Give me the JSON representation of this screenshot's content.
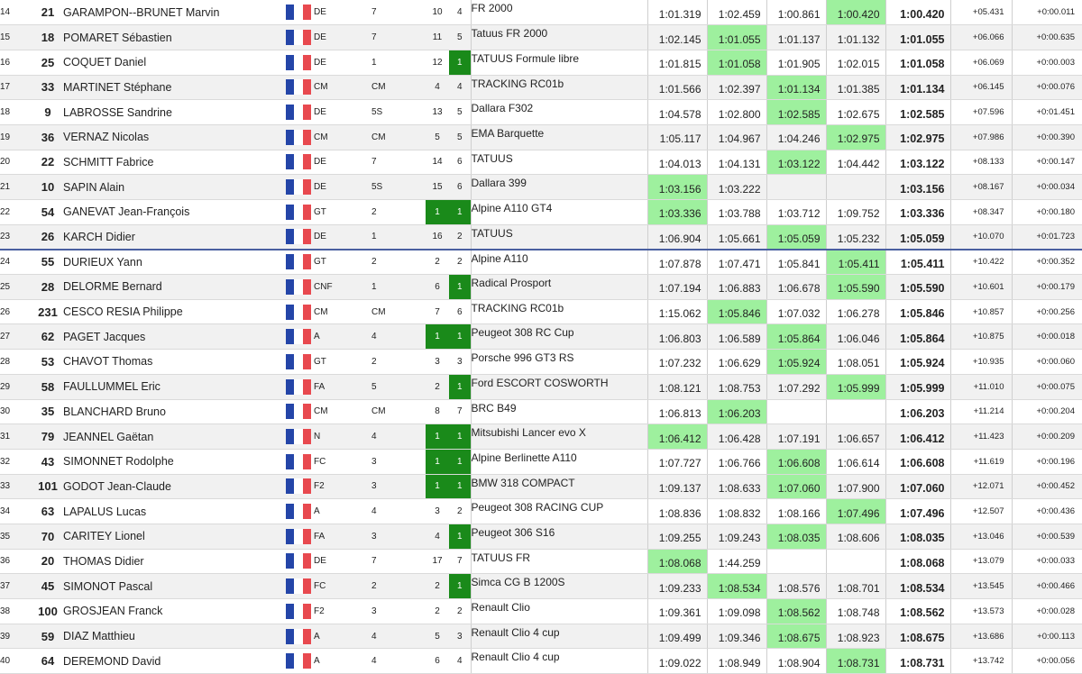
{
  "colors": {
    "highlight": "#9ef09e",
    "green_box": "#1a8a1a",
    "separator": "#4a5fa0",
    "flag_blue": "#2445a8",
    "flag_white": "#ffffff",
    "flag_red": "#e8494f"
  },
  "rows": [
    {
      "rank": "14",
      "num": "21",
      "name": "GARAMPON--BRUNET Marvin",
      "cat": "DE",
      "cls": "7",
      "p1": "10",
      "p2": "4",
      "car": "FR 2000",
      "t1": "1:01.319",
      "t2": "1:02.459",
      "t3": "1:00.861",
      "t4": "1:00.420",
      "best": "1:00.420",
      "gap": "+05.431",
      "diff": "+0:00.011",
      "hl": [
        4
      ],
      "g1": false,
      "g2": false
    },
    {
      "rank": "15",
      "num": "18",
      "name": "POMARET Sébastien",
      "cat": "DE",
      "cls": "7",
      "p1": "11",
      "p2": "5",
      "car": "Tatuus FR 2000",
      "t1": "1:02.145",
      "t2": "1:01.055",
      "t3": "1:01.137",
      "t4": "1:01.132",
      "best": "1:01.055",
      "gap": "+06.066",
      "diff": "+0:00.635",
      "hl": [
        2
      ],
      "g1": false,
      "g2": false
    },
    {
      "rank": "16",
      "num": "25",
      "name": "COQUET Daniel",
      "cat": "DE",
      "cls": "1",
      "p1": "12",
      "p2": "1",
      "car": "TATUUS Formule libre",
      "t1": "1:01.815",
      "t2": "1:01.058",
      "t3": "1:01.905",
      "t4": "1:02.015",
      "best": "1:01.058",
      "gap": "+06.069",
      "diff": "+0:00.003",
      "hl": [
        2
      ],
      "g1": false,
      "g2": true
    },
    {
      "rank": "17",
      "num": "33",
      "name": "MARTINET Stéphane",
      "cat": "CM",
      "cls": "CM",
      "p1": "4",
      "p2": "4",
      "car": "TRACKING RC01b",
      "t1": "1:01.566",
      "t2": "1:02.397",
      "t3": "1:01.134",
      "t4": "1:01.385",
      "best": "1:01.134",
      "gap": "+06.145",
      "diff": "+0:00.076",
      "hl": [
        3
      ],
      "g1": false,
      "g2": false
    },
    {
      "rank": "18",
      "num": "9",
      "name": "LABROSSE Sandrine",
      "cat": "DE",
      "cls": "5S",
      "p1": "13",
      "p2": "5",
      "car": "Dallara F302",
      "t1": "1:04.578",
      "t2": "1:02.800",
      "t3": "1:02.585",
      "t4": "1:02.675",
      "best": "1:02.585",
      "gap": "+07.596",
      "diff": "+0:01.451",
      "hl": [
        3
      ],
      "g1": false,
      "g2": false
    },
    {
      "rank": "19",
      "num": "36",
      "name": "VERNAZ Nicolas",
      "cat": "CM",
      "cls": "CM",
      "p1": "5",
      "p2": "5",
      "car": "EMA Barquette",
      "t1": "1:05.117",
      "t2": "1:04.967",
      "t3": "1:04.246",
      "t4": "1:02.975",
      "best": "1:02.975",
      "gap": "+07.986",
      "diff": "+0:00.390",
      "hl": [
        4
      ],
      "g1": false,
      "g2": false
    },
    {
      "rank": "20",
      "num": "22",
      "name": "SCHMITT Fabrice",
      "cat": "DE",
      "cls": "7",
      "p1": "14",
      "p2": "6",
      "car": "TATUUS",
      "t1": "1:04.013",
      "t2": "1:04.131",
      "t3": "1:03.122",
      "t4": "1:04.442",
      "best": "1:03.122",
      "gap": "+08.133",
      "diff": "+0:00.147",
      "hl": [
        3
      ],
      "g1": false,
      "g2": false
    },
    {
      "rank": "21",
      "num": "10",
      "name": "SAPIN Alain",
      "cat": "DE",
      "cls": "5S",
      "p1": "15",
      "p2": "6",
      "car": "Dallara 399",
      "t1": "1:03.156",
      "t2": "1:03.222",
      "t3": "",
      "t4": "",
      "best": "1:03.156",
      "gap": "+08.167",
      "diff": "+0:00.034",
      "hl": [
        1
      ],
      "g1": false,
      "g2": false
    },
    {
      "rank": "22",
      "num": "54",
      "name": "GANEVAT Jean-François",
      "cat": "GT",
      "cls": "2",
      "p1": "1",
      "p2": "1",
      "car": "Alpine A110 GT4",
      "t1": "1:03.336",
      "t2": "1:03.788",
      "t3": "1:03.712",
      "t4": "1:09.752",
      "best": "1:03.336",
      "gap": "+08.347",
      "diff": "+0:00.180",
      "hl": [
        1
      ],
      "g1": true,
      "g2": true
    },
    {
      "rank": "23",
      "num": "26",
      "name": "KARCH Didier",
      "cat": "DE",
      "cls": "1",
      "p1": "16",
      "p2": "2",
      "car": "TATUUS",
      "t1": "1:06.904",
      "t2": "1:05.661",
      "t3": "1:05.059",
      "t4": "1:05.232",
      "best": "1:05.059",
      "gap": "+10.070",
      "diff": "+0:01.723",
      "hl": [
        3
      ],
      "g1": false,
      "g2": false,
      "sep": true
    },
    {
      "rank": "24",
      "num": "55",
      "name": "DURIEUX Yann",
      "cat": "GT",
      "cls": "2",
      "p1": "2",
      "p2": "2",
      "car": "Alpine A110",
      "t1": "1:07.878",
      "t2": "1:07.471",
      "t3": "1:05.841",
      "t4": "1:05.411",
      "best": "1:05.411",
      "gap": "+10.422",
      "diff": "+0:00.352",
      "hl": [
        4
      ],
      "g1": false,
      "g2": false
    },
    {
      "rank": "25",
      "num": "28",
      "name": "DELORME Bernard",
      "cat": "CNF",
      "cls": "1",
      "p1": "6",
      "p2": "1",
      "car": "Radical Prosport",
      "t1": "1:07.194",
      "t2": "1:06.883",
      "t3": "1:06.678",
      "t4": "1:05.590",
      "best": "1:05.590",
      "gap": "+10.601",
      "diff": "+0:00.179",
      "hl": [
        4
      ],
      "g1": false,
      "g2": true
    },
    {
      "rank": "26",
      "num": "231",
      "name": "CESCO RESIA Philippe",
      "cat": "CM",
      "cls": "CM",
      "p1": "7",
      "p2": "6",
      "car": "TRACKING RC01b",
      "t1": "1:15.062",
      "t2": "1:05.846",
      "t3": "1:07.032",
      "t4": "1:06.278",
      "best": "1:05.846",
      "gap": "+10.857",
      "diff": "+0:00.256",
      "hl": [
        2
      ],
      "g1": false,
      "g2": false
    },
    {
      "rank": "27",
      "num": "62",
      "name": "PAGET Jacques",
      "cat": "A",
      "cls": "4",
      "p1": "1",
      "p2": "1",
      "car": "Peugeot 308 RC Cup",
      "t1": "1:06.803",
      "t2": "1:06.589",
      "t3": "1:05.864",
      "t4": "1:06.046",
      "best": "1:05.864",
      "gap": "+10.875",
      "diff": "+0:00.018",
      "hl": [
        3
      ],
      "g1": true,
      "g2": true
    },
    {
      "rank": "28",
      "num": "53",
      "name": "CHAVOT Thomas",
      "cat": "GT",
      "cls": "2",
      "p1": "3",
      "p2": "3",
      "car": "Porsche 996 GT3 RS",
      "t1": "1:07.232",
      "t2": "1:06.629",
      "t3": "1:05.924",
      "t4": "1:08.051",
      "best": "1:05.924",
      "gap": "+10.935",
      "diff": "+0:00.060",
      "hl": [
        3
      ],
      "g1": false,
      "g2": false
    },
    {
      "rank": "29",
      "num": "58",
      "name": "FAULLUMMEL Eric",
      "cat": "FA",
      "cls": "5",
      "p1": "2",
      "p2": "1",
      "car": "Ford ESCORT COSWORTH",
      "t1": "1:08.121",
      "t2": "1:08.753",
      "t3": "1:07.292",
      "t4": "1:05.999",
      "best": "1:05.999",
      "gap": "+11.010",
      "diff": "+0:00.075",
      "hl": [
        4
      ],
      "g1": false,
      "g2": true
    },
    {
      "rank": "30",
      "num": "35",
      "name": "BLANCHARD Bruno",
      "cat": "CM",
      "cls": "CM",
      "p1": "8",
      "p2": "7",
      "car": "BRC B49",
      "t1": "1:06.813",
      "t2": "1:06.203",
      "t3": "",
      "t4": "",
      "best": "1:06.203",
      "gap": "+11.214",
      "diff": "+0:00.204",
      "hl": [
        2
      ],
      "g1": false,
      "g2": false
    },
    {
      "rank": "31",
      "num": "79",
      "name": "JEANNEL Gaëtan",
      "cat": "N",
      "cls": "4",
      "p1": "1",
      "p2": "1",
      "car": "Mitsubishi Lancer evo X",
      "t1": "1:06.412",
      "t2": "1:06.428",
      "t3": "1:07.191",
      "t4": "1:06.657",
      "best": "1:06.412",
      "gap": "+11.423",
      "diff": "+0:00.209",
      "hl": [
        1
      ],
      "g1": true,
      "g2": true
    },
    {
      "rank": "32",
      "num": "43",
      "name": "SIMONNET Rodolphe",
      "cat": "FC",
      "cls": "3",
      "p1": "1",
      "p2": "1",
      "car": "Alpine Berlinette A110",
      "t1": "1:07.727",
      "t2": "1:06.766",
      "t3": "1:06.608",
      "t4": "1:06.614",
      "best": "1:06.608",
      "gap": "+11.619",
      "diff": "+0:00.196",
      "hl": [
        3
      ],
      "g1": true,
      "g2": true
    },
    {
      "rank": "33",
      "num": "101",
      "name": "GODOT Jean-Claude",
      "cat": "F2",
      "cls": "3",
      "p1": "1",
      "p2": "1",
      "car": "BMW 318 COMPACT",
      "t1": "1:09.137",
      "t2": "1:08.633",
      "t3": "1:07.060",
      "t4": "1:07.900",
      "best": "1:07.060",
      "gap": "+12.071",
      "diff": "+0:00.452",
      "hl": [
        3
      ],
      "g1": true,
      "g2": true
    },
    {
      "rank": "34",
      "num": "63",
      "name": "LAPALUS Lucas",
      "cat": "A",
      "cls": "4",
      "p1": "3",
      "p2": "2",
      "car": "Peugeot 308 RACING CUP",
      "t1": "1:08.836",
      "t2": "1:08.832",
      "t3": "1:08.166",
      "t4": "1:07.496",
      "best": "1:07.496",
      "gap": "+12.507",
      "diff": "+0:00.436",
      "hl": [
        4
      ],
      "g1": false,
      "g2": false
    },
    {
      "rank": "35",
      "num": "70",
      "name": "CARITEY Lionel",
      "cat": "FA",
      "cls": "3",
      "p1": "4",
      "p2": "1",
      "car": "Peugeot 306 S16",
      "t1": "1:09.255",
      "t2": "1:09.243",
      "t3": "1:08.035",
      "t4": "1:08.606",
      "best": "1:08.035",
      "gap": "+13.046",
      "diff": "+0:00.539",
      "hl": [
        3
      ],
      "g1": false,
      "g2": true
    },
    {
      "rank": "36",
      "num": "20",
      "name": "THOMAS Didier",
      "cat": "DE",
      "cls": "7",
      "p1": "17",
      "p2": "7",
      "car": "TATUUS FR",
      "t1": "1:08.068",
      "t2": "1:44.259",
      "t3": "",
      "t4": "",
      "best": "1:08.068",
      "gap": "+13.079",
      "diff": "+0:00.033",
      "hl": [
        1
      ],
      "g1": false,
      "g2": false
    },
    {
      "rank": "37",
      "num": "45",
      "name": "SIMONOT Pascal",
      "cat": "FC",
      "cls": "2",
      "p1": "2",
      "p2": "1",
      "car": "Simca CG B 1200S",
      "t1": "1:09.233",
      "t2": "1:08.534",
      "t3": "1:08.576",
      "t4": "1:08.701",
      "best": "1:08.534",
      "gap": "+13.545",
      "diff": "+0:00.466",
      "hl": [
        2
      ],
      "g1": false,
      "g2": true
    },
    {
      "rank": "38",
      "num": "100",
      "name": "GROSJEAN Franck",
      "cat": "F2",
      "cls": "3",
      "p1": "2",
      "p2": "2",
      "car": "Renault Clio",
      "t1": "1:09.361",
      "t2": "1:09.098",
      "t3": "1:08.562",
      "t4": "1:08.748",
      "best": "1:08.562",
      "gap": "+13.573",
      "diff": "+0:00.028",
      "hl": [
        3
      ],
      "g1": false,
      "g2": false
    },
    {
      "rank": "39",
      "num": "59",
      "name": "DIAZ Matthieu",
      "cat": "A",
      "cls": "4",
      "p1": "5",
      "p2": "3",
      "car": "Renault Clio 4 cup",
      "t1": "1:09.499",
      "t2": "1:09.346",
      "t3": "1:08.675",
      "t4": "1:08.923",
      "best": "1:08.675",
      "gap": "+13.686",
      "diff": "+0:00.113",
      "hl": [
        3
      ],
      "g1": false,
      "g2": false
    },
    {
      "rank": "40",
      "num": "64",
      "name": "DEREMOND David",
      "cat": "A",
      "cls": "4",
      "p1": "6",
      "p2": "4",
      "car": "Renault Clio 4 cup",
      "t1": "1:09.022",
      "t2": "1:08.949",
      "t3": "1:08.904",
      "t4": "1:08.731",
      "best": "1:08.731",
      "gap": "+13.742",
      "diff": "+0:00.056",
      "hl": [
        4
      ],
      "g1": false,
      "g2": false
    }
  ]
}
